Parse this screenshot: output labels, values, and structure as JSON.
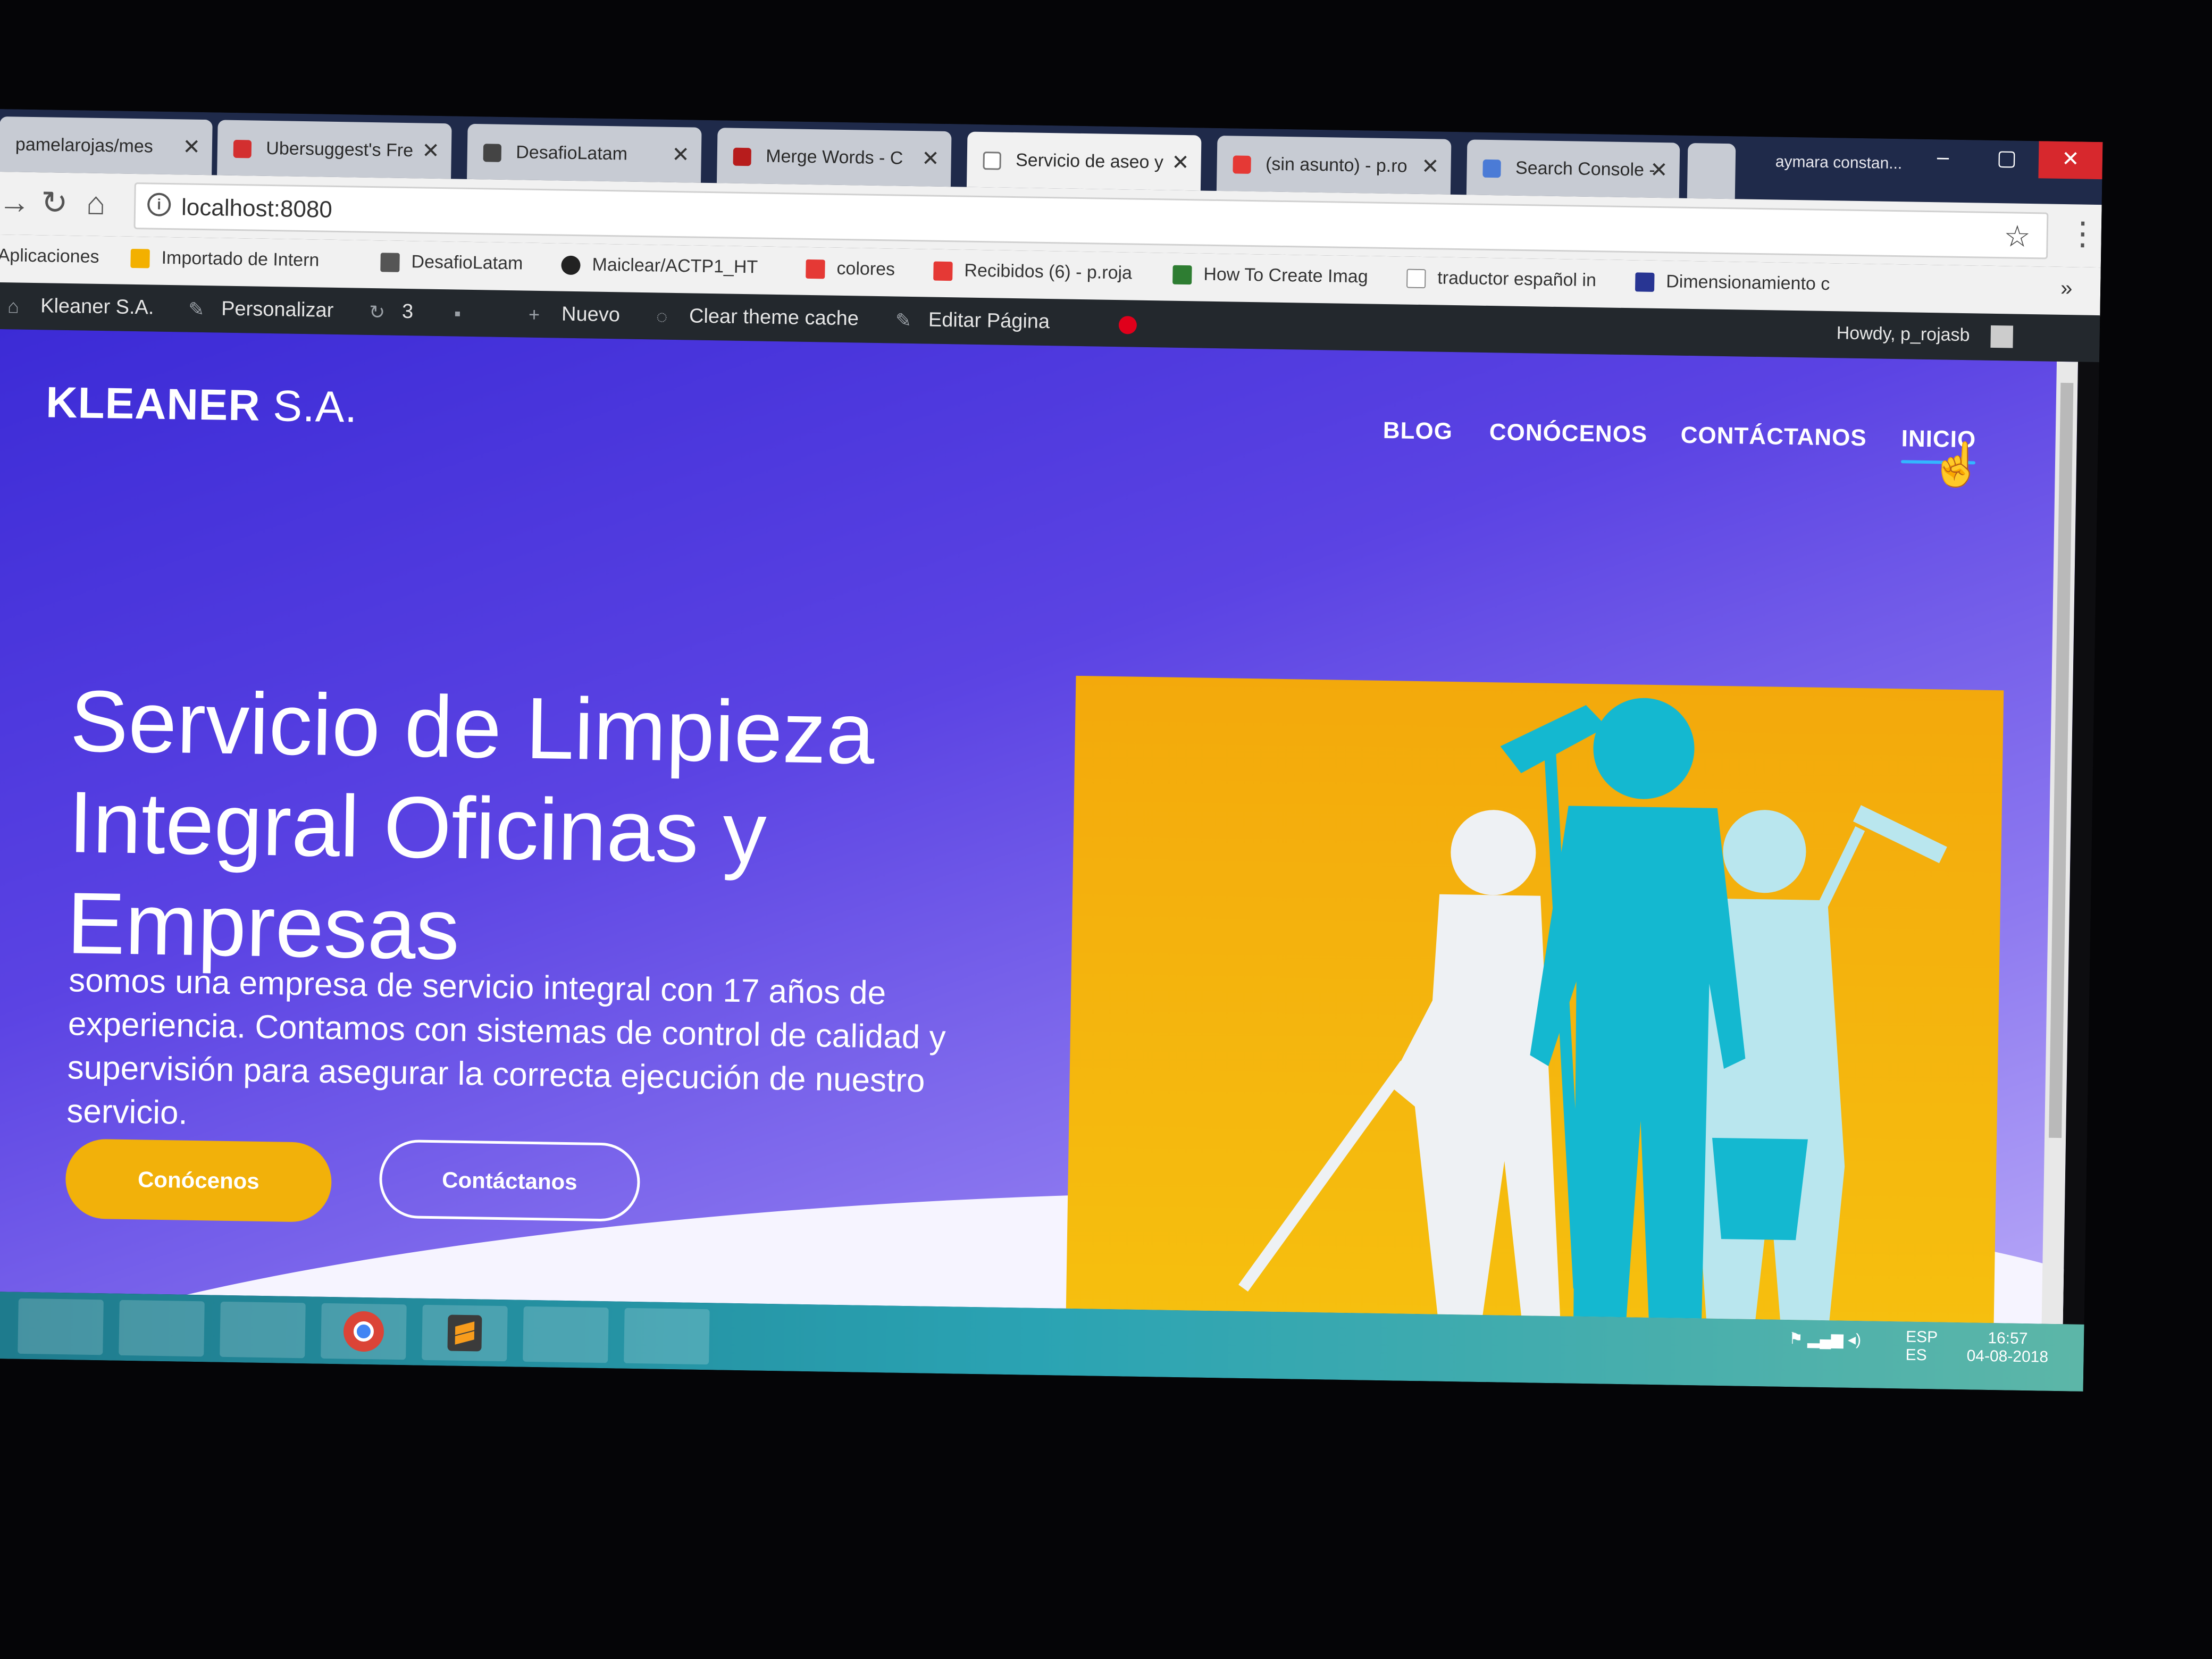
{
  "browser": {
    "tabs": [
      {
        "label": "pamelarojas/mes",
        "active": false
      },
      {
        "label": "Ubersuggest's Fre",
        "active": false
      },
      {
        "label": "DesafioLatam",
        "active": false
      },
      {
        "label": "Merge Words - C",
        "active": false
      },
      {
        "label": "Servicio de aseo y",
        "active": true
      },
      {
        "label": "(sin asunto) - p.ro",
        "active": false
      },
      {
        "label": "Search Console -",
        "active": false
      }
    ],
    "window_user": "aymara constan...",
    "url": "localhost:8080",
    "bookmarks": [
      "Aplicaciones",
      "Importado de Intern",
      "DesafioLatam",
      "Maiclear/ACTP1_HT",
      "colores",
      "Recibidos (6) - p.roja",
      "How To Create Imag",
      "traductor español in",
      "Dimensionamiento c"
    ]
  },
  "adminbar": {
    "site": "Kleaner S.A.",
    "customize": "Personalizar",
    "updates": "3",
    "new": "Nuevo",
    "clear_cache": "Clear theme cache",
    "edit_page": "Editar Página",
    "howdy": "Howdy, p_rojasb"
  },
  "site": {
    "logo_bold": "KLEANER",
    "logo_rest": " S.A.",
    "nav": [
      "BLOG",
      "CONÓCENOS",
      "CONTÁCTANOS",
      "INICIO"
    ],
    "active_nav": "INICIO",
    "headline": "Servicio de Limpieza Integral Oficinas y Empresas",
    "lead": "somos una empresa de servicio integral con 17 años de experiencia. Contamos con sistemas de control de calidad y supervisión para asegurar la correcta ejecución de nuestro servicio.",
    "btn_primary": "Conócenos",
    "btn_secondary": "Contáctanos"
  },
  "taskbar": {
    "lang_top": "ESP",
    "lang_bottom": "ES",
    "time": "16:57",
    "date": "04-08-2018"
  },
  "colors": {
    "hero_start": "#3c2bd6",
    "accent_yellow": "#f2b10a",
    "figure_cyan": "#14b8d0",
    "figure_light": "#b8e9f0"
  }
}
